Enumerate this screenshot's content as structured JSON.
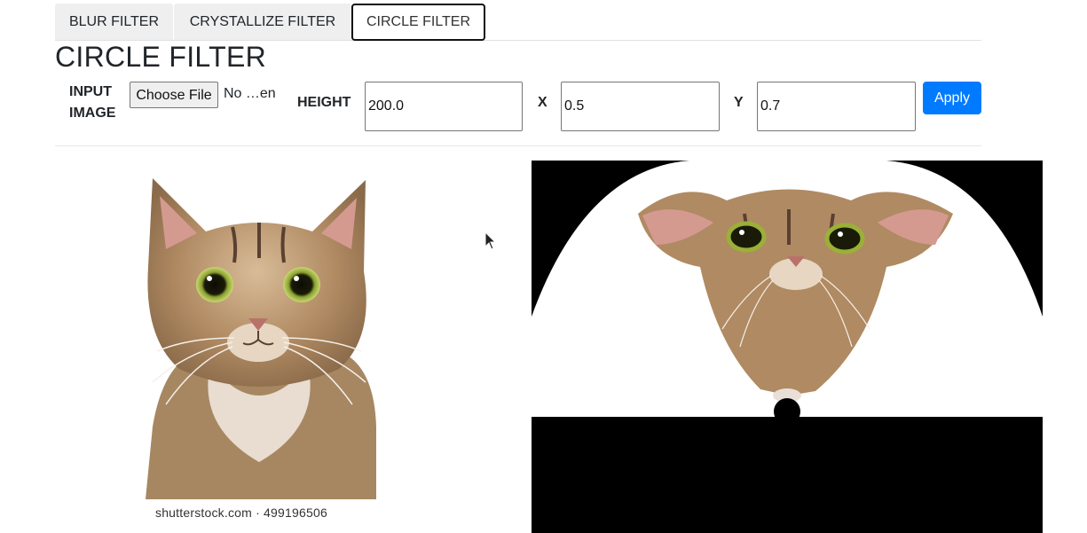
{
  "tabs": [
    {
      "label": "BLUR FILTER",
      "active": false
    },
    {
      "label": "CRYSTALLIZE FILTER",
      "active": false
    },
    {
      "label": "CIRCLE FILTER",
      "active": true
    }
  ],
  "page_title": "CIRCLE FILTER",
  "form": {
    "input_image_label_line1": "INPUT",
    "input_image_label_line2": "IMAGE",
    "choose_file_label": "Choose File",
    "file_status": "No …en",
    "height_label": "HEIGHT",
    "height_value": "200.0",
    "x_label": "X",
    "x_value": "0.5",
    "y_label": "Y",
    "y_value": "0.7",
    "apply_label": "Apply"
  },
  "images": {
    "original_credit": "shutterstock.com · 499196506"
  },
  "colors": {
    "accent": "#007bff",
    "tab_bg": "#efefef",
    "output_bg": "#000000"
  }
}
